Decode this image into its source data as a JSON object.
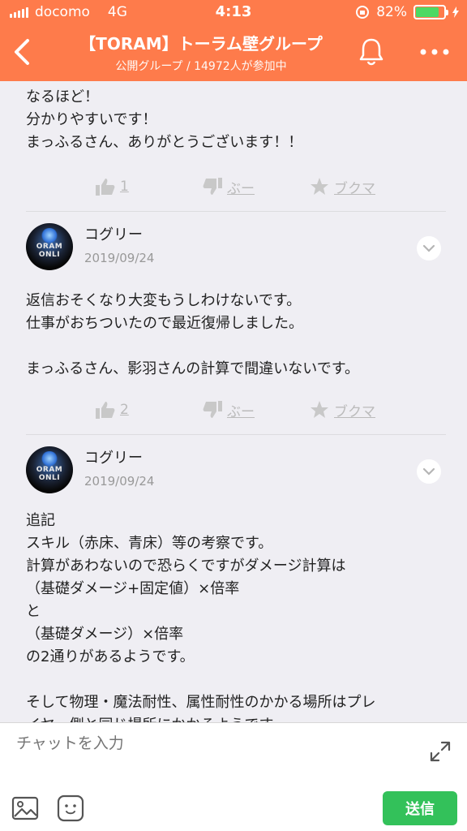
{
  "status": {
    "carrier": "docomo",
    "network": "4G",
    "time": "4:13",
    "battery": "82%",
    "battery_level": 0.82,
    "battery_color": "#4cd964"
  },
  "header": {
    "title": "【TORAM】トーラム壁グループ",
    "subtitle": "公開グループ / 14972人が参加中",
    "background": "#fe7b4b"
  },
  "messages": [
    {
      "text": "なるほど！\n分かりやすいです！\nまっふるさん、ありがとうございます！！",
      "like_count": "1",
      "boo_label": "ぶー",
      "bookmark_label": "ブクマ"
    },
    {
      "author": "コグリー",
      "avatar_text": "ORAM ONLI",
      "date": "2019/09/24",
      "text": "返信おそくなり大変もうしわけないです。\n仕事がおちついたので最近復帰しました。\n\nまっふるさん、影羽さんの計算で間違いないです。",
      "like_count": "2",
      "boo_label": "ぶー",
      "bookmark_label": "ブクマ"
    },
    {
      "author": "コグリー",
      "avatar_text": "ORAM ONLI",
      "date": "2019/09/24",
      "text": "追記\nスキル（赤床、青床）等の考察です。\n計算があわないので恐らくですがダメージ計算は\n（基礎ダメージ+固定値）×倍率\nと\n（基礎ダメージ）×倍率\nの2通りがあるようです。\n\nそして物理・魔法耐性、属性耐性のかかる場所はプレ\nイヤー側と同じ場所にかかるようです。\n精錬値やdef・mdefの計算式はまだ検証できておりま"
    }
  ],
  "composer": {
    "placeholder": "チャットを入力",
    "send_label": "送信",
    "send_color": "#33c15a"
  }
}
